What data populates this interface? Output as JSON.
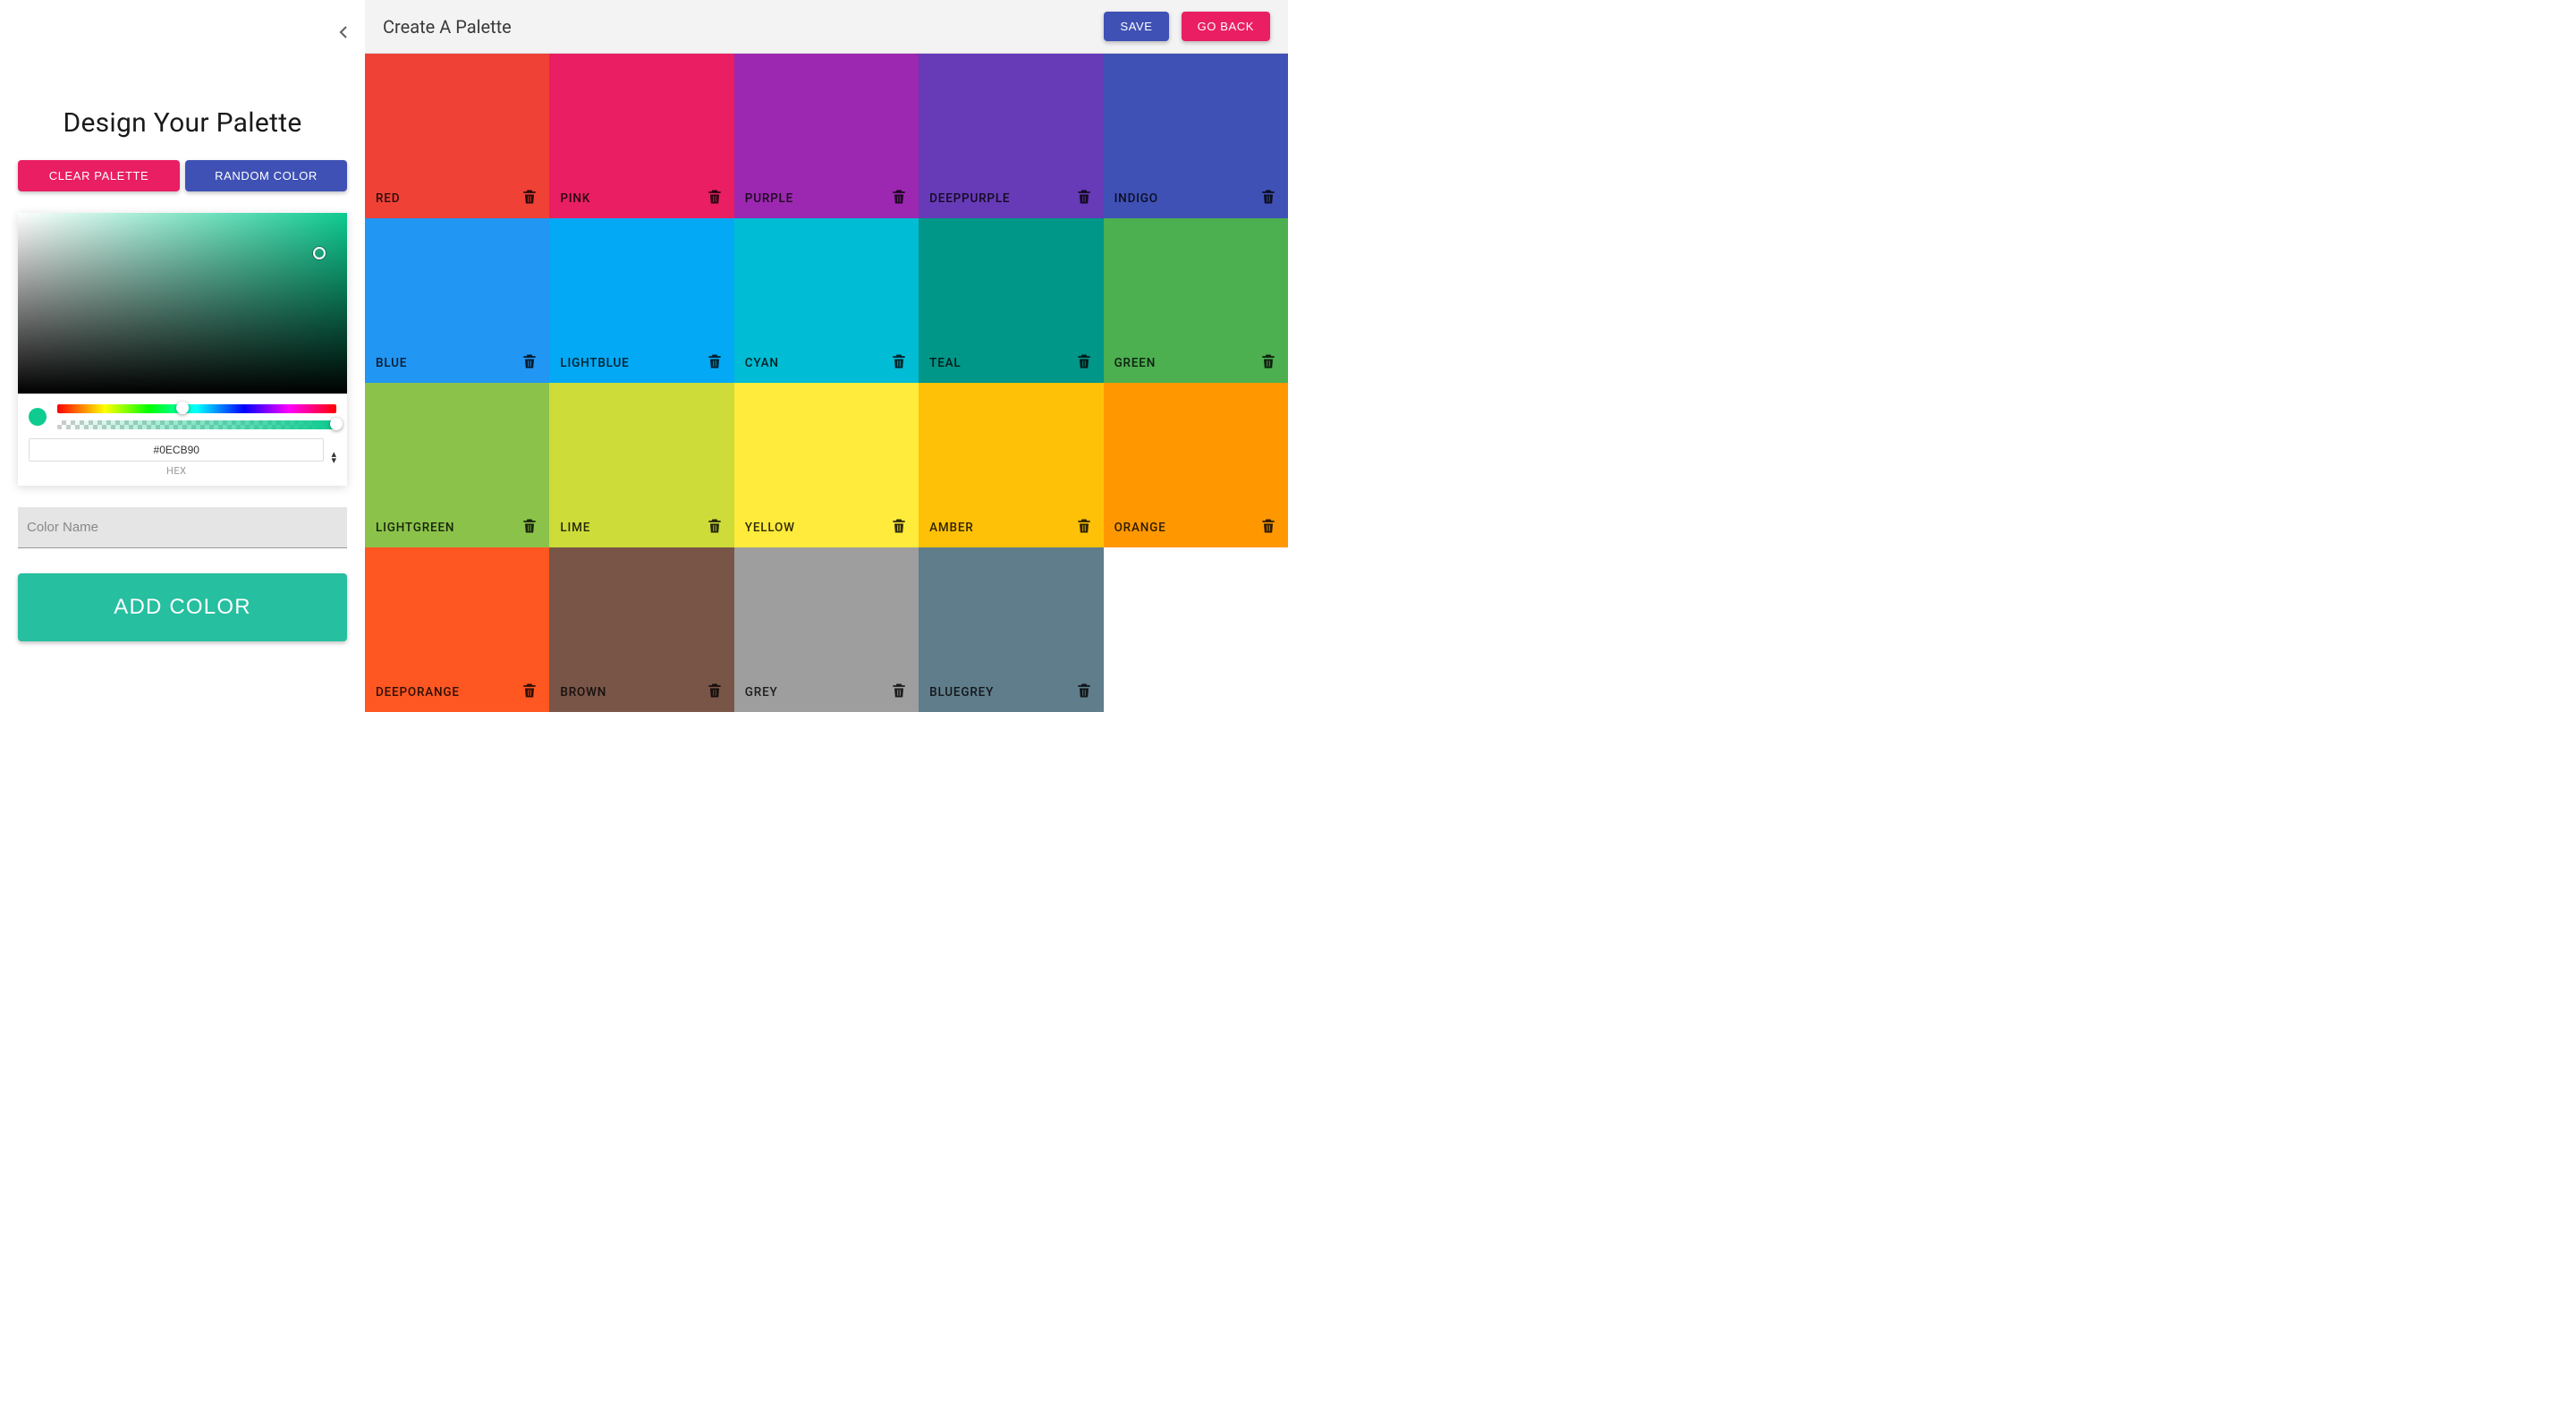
{
  "sidebar": {
    "title": "Design Your Palette",
    "clear_label": "CLEAR PALETTE",
    "random_label": "RANDOM COLOR",
    "hex_value": "#0ECB90",
    "hex_label": "HEX",
    "name_placeholder": "Color Name",
    "add_label": "ADD COLOR",
    "picker_color": "#0ECB90"
  },
  "topbar": {
    "title": "Create A Palette",
    "save_label": "SAVE",
    "back_label": "GO BACK"
  },
  "swatches": [
    {
      "name": "RED",
      "hex": "#ef4136"
    },
    {
      "name": "PINK",
      "hex": "#e91e63"
    },
    {
      "name": "PURPLE",
      "hex": "#9c27b0"
    },
    {
      "name": "DEEPPURPLE",
      "hex": "#673ab7"
    },
    {
      "name": "INDIGO",
      "hex": "#3f51b5"
    },
    {
      "name": "BLUE",
      "hex": "#2196f3"
    },
    {
      "name": "LIGHTBLUE",
      "hex": "#03a9f4"
    },
    {
      "name": "CYAN",
      "hex": "#00bcd4"
    },
    {
      "name": "TEAL",
      "hex": "#009688"
    },
    {
      "name": "GREEN",
      "hex": "#4caf50"
    },
    {
      "name": "LIGHTGREEN",
      "hex": "#8bc34a"
    },
    {
      "name": "LIME",
      "hex": "#cddc39"
    },
    {
      "name": "YELLOW",
      "hex": "#ffeb3b"
    },
    {
      "name": "AMBER",
      "hex": "#ffc107"
    },
    {
      "name": "ORANGE",
      "hex": "#ff9800"
    },
    {
      "name": "DEEPORANGE",
      "hex": "#ff5722"
    },
    {
      "name": "BROWN",
      "hex": "#795548"
    },
    {
      "name": "GREY",
      "hex": "#9e9e9e"
    },
    {
      "name": "BLUEGREY",
      "hex": "#607d8b"
    }
  ]
}
